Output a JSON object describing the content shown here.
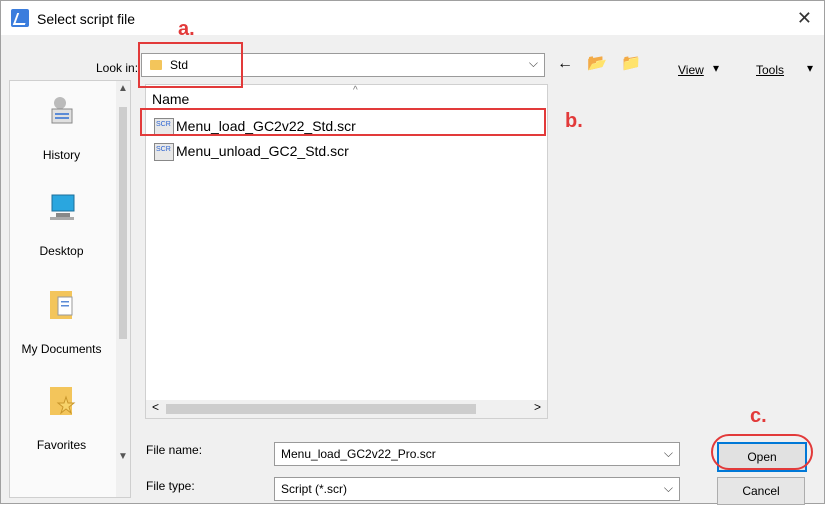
{
  "window": {
    "title": "Select script file",
    "close_glyph": "✕"
  },
  "toolbar": {
    "lookin_label": "Look in:",
    "lookin_value": "Std",
    "view_label": "View",
    "tools_label": "Tools",
    "back_icon": "←",
    "up_icon": "📂",
    "newfolder_icon": "📁"
  },
  "places": [
    {
      "label": "History"
    },
    {
      "label": "Desktop"
    },
    {
      "label": "My Documents"
    },
    {
      "label": "Favorites"
    }
  ],
  "filelist": {
    "header": "Name",
    "files": [
      {
        "name": "Menu_load_GC2v22_Std.scr"
      },
      {
        "name": "Menu_unload_GC2_Std.scr"
      }
    ]
  },
  "form": {
    "filename_label": "File name:",
    "filename_value": "Menu_load_GC2v22_Pro.scr",
    "filetype_label": "File type:",
    "filetype_value": "Script (*.scr)",
    "open_label": "Open",
    "cancel_label": "Cancel"
  },
  "annotations": {
    "a": "a.",
    "b": "b.",
    "c": "c."
  },
  "colors": {
    "annotation": "#e23a3a",
    "focus": "#0078d7"
  }
}
